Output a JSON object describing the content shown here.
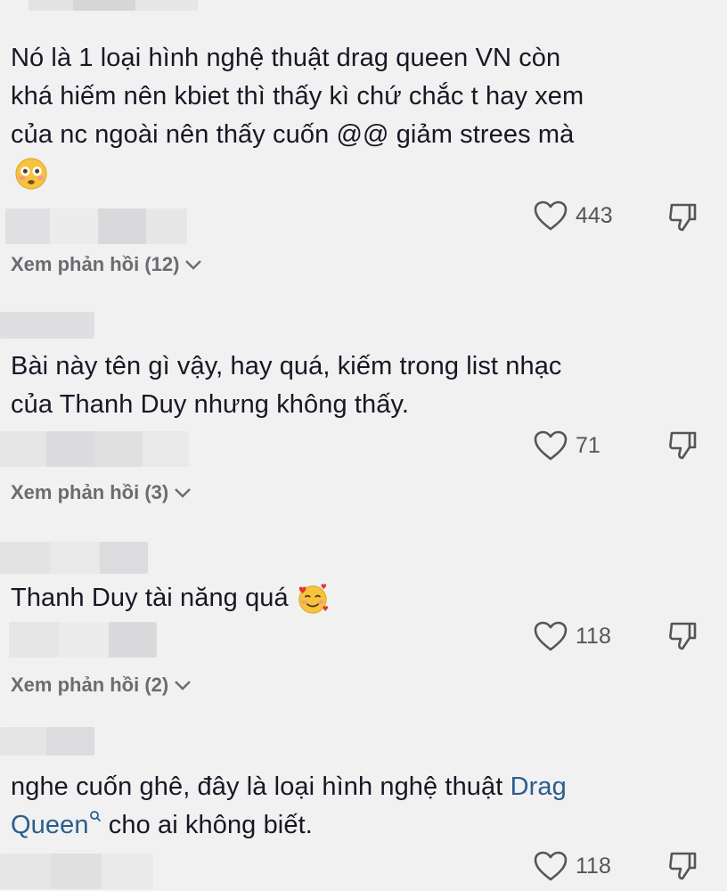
{
  "comments": [
    {
      "text_lines": [
        "Nó là 1 loại hình nghệ thuật drag queen VN còn",
        "khá hiếm nên kbiet thì thấy kì chứ chắc t hay xem",
        "của nc ngoài nên thấy cuốn @@ giảm strees mà"
      ],
      "emoji": "flushed-face",
      "likes": "443",
      "replies_label": "Xem phản hồi (12)"
    },
    {
      "text_lines": [
        "Bài này tên gì vậy, hay quá, kiếm trong list nhạc",
        "của Thanh Duy nhưng không thấy."
      ],
      "likes": "71",
      "replies_label": "Xem phản hồi (3)"
    },
    {
      "text": "Thanh Duy tài năng quá",
      "emoji": "smiling-face-with-hearts",
      "likes": "118",
      "replies_label": "Xem phản hồi (2)"
    },
    {
      "text_before": "nghe cuốn ghê, đây là loại hình nghệ thuật",
      "link_part1": "Drag",
      "link_part2": "Queen",
      "text_after": "cho ai không biết.",
      "likes": "118"
    }
  ],
  "colors": {
    "background": "#f1f1f2",
    "text": "#161823",
    "link": "#2b5d8c",
    "muted": "#6b6b70"
  }
}
